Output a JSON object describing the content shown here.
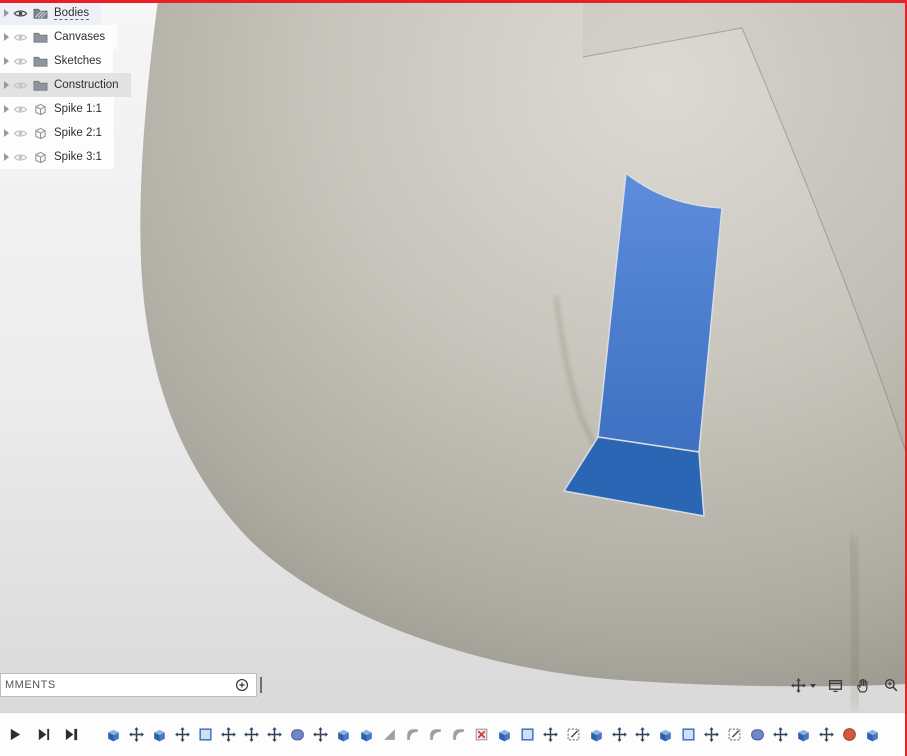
{
  "browser": {
    "items": [
      {
        "label": "Bodies",
        "icon": "bodies-folder",
        "visible": true,
        "state": "renaming"
      },
      {
        "label": "Canvases",
        "icon": "folder",
        "visible": false,
        "state": ""
      },
      {
        "label": "Sketches",
        "icon": "folder",
        "visible": false,
        "state": ""
      },
      {
        "label": "Construction",
        "icon": "folder",
        "visible": false,
        "state": "hover"
      },
      {
        "label": "Spike 1:1",
        "icon": "body",
        "visible": false,
        "state": ""
      },
      {
        "label": "Spike 2:1",
        "icon": "body",
        "visible": false,
        "state": ""
      },
      {
        "label": "Spike 3:1",
        "icon": "body",
        "visible": false,
        "state": ""
      }
    ]
  },
  "comments_bar": {
    "label": "MMENTS",
    "add_icon": "circle-plus-icon"
  },
  "nav_bar": {
    "icons": [
      {
        "name": "orbit",
        "dropdown": true
      },
      {
        "name": "display",
        "dropdown": false
      },
      {
        "name": "pan",
        "dropdown": false
      },
      {
        "name": "zoom",
        "dropdown": false
      }
    ]
  },
  "timeline": {
    "playback": [
      {
        "name": "play"
      },
      {
        "name": "step-forward"
      },
      {
        "name": "skip-end"
      }
    ],
    "features": [
      "extrude",
      "move",
      "extrude",
      "move",
      "boxsel",
      "move",
      "move",
      "move",
      "form",
      "move",
      "extrude",
      "extrude",
      "chamfer",
      "fillet",
      "fillet",
      "fillet",
      "error",
      "extrude",
      "boxsel",
      "move",
      "sketch",
      "extrude",
      "move",
      "move",
      "extrude",
      "boxsel",
      "move",
      "sketch",
      "form",
      "move",
      "extrude",
      "move",
      "sphere",
      "extrude"
    ]
  },
  "colors": {
    "selected_face": "#4a7ed3",
    "selected_face_floor": "#2b66b4",
    "model": "#c6c3bb",
    "viewport_background_top": "#f6f6f6",
    "viewport_background_bottom": "#d9d9d9",
    "capture_border": "#e92127"
  }
}
